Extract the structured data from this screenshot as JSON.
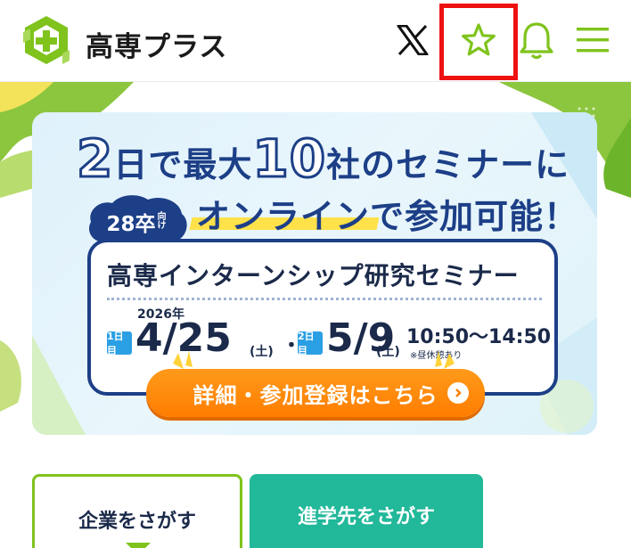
{
  "header": {
    "brand": "高専プラス",
    "icons": [
      "x-logo-icon",
      "star-icon",
      "bell-icon",
      "hamburger-menu-icon"
    ]
  },
  "banner": {
    "headline_num1": "2",
    "headline_part1": "日で最大",
    "headline_num2": "10",
    "headline_part2": "社のセミナーに",
    "headline_line2": "オンラインで参加可能！",
    "badge_num": "28卒",
    "badge_small": "向け",
    "card_title": "高専インターンシップ研究セミナー",
    "year": "2026年",
    "day1_tag": "1日目",
    "date1": "4/25",
    "dow1": "(土)",
    "separator": "・",
    "day2_tag": "2日目",
    "date2": "5/9",
    "dow2": "(土)",
    "time": "10:50〜14:50",
    "note": "※昼休憩あり",
    "cta_label": "詳細・参加登録はこちら"
  },
  "nav_buttons": {
    "company": "企業をさがす",
    "school": "進学先をさがす"
  },
  "colors": {
    "brand_green": "#7fc31c",
    "navy": "#1d3f87",
    "cta_orange": "#ff8a0a",
    "teal": "#22b89a",
    "highlight_red": "#ee1111"
  }
}
